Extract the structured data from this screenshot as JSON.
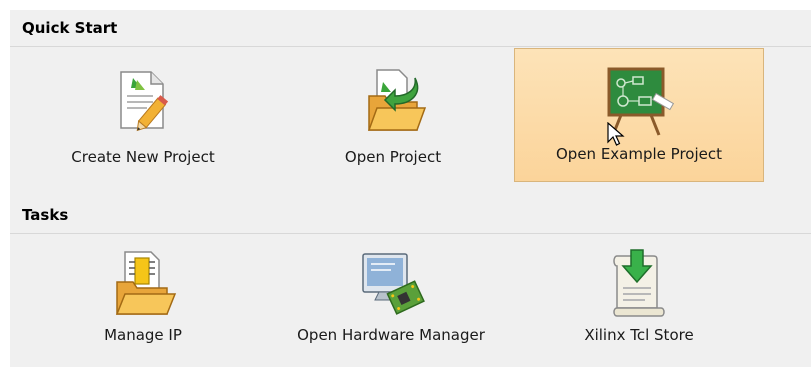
{
  "quick_start": {
    "title": "Quick Start",
    "items": [
      {
        "label": "Create New Project",
        "icon": "create-project-icon"
      },
      {
        "label": "Open Project",
        "icon": "open-project-icon"
      },
      {
        "label": "Open Example Project",
        "icon": "example-project-icon",
        "highlighted": true
      }
    ]
  },
  "tasks": {
    "title": "Tasks",
    "items": [
      {
        "label": "Manage IP",
        "icon": "manage-ip-icon"
      },
      {
        "label": "Open Hardware Manager",
        "icon": "hardware-manager-icon"
      },
      {
        "label": "Xilinx Tcl Store",
        "icon": "tcl-store-icon"
      }
    ]
  },
  "colors": {
    "highlight_bg": "#fbd49a",
    "highlight_border": "#d9b57c",
    "panel_bg": "#f0f0f0"
  }
}
